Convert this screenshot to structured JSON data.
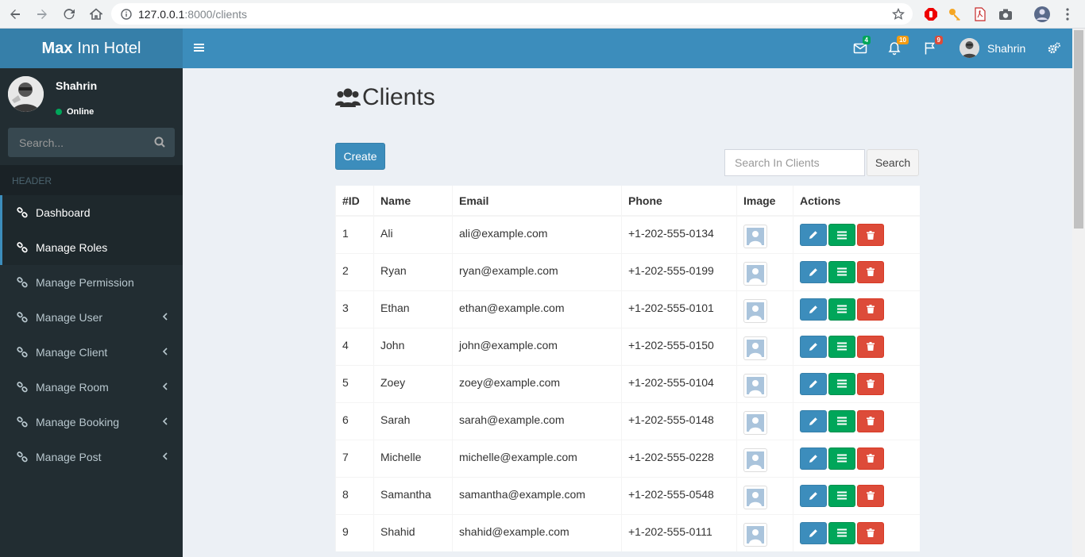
{
  "browser": {
    "url_host": "127.0.0.1",
    "url_path": ":8000/clients"
  },
  "header": {
    "brand_bold": "Max",
    "brand_rest": "Inn Hotel",
    "messages_count": "4",
    "notifications_count": "10",
    "flags_count": "9",
    "user_name": "Shahrin",
    "colors": {
      "topbar": "#3c8dbc",
      "logo": "#367fa9",
      "msg_badge": "#00a65a",
      "notif_badge": "#f39c12",
      "flag_badge": "#dd4b39"
    }
  },
  "sidebar": {
    "user_name": "Shahrin",
    "status": "Online",
    "search_placeholder": "Search...",
    "header": "HEADER",
    "items": [
      {
        "label": "Dashboard",
        "active": true
      },
      {
        "label": "Manage Roles",
        "active": true
      },
      {
        "label": "Manage Permission"
      },
      {
        "label": "Manage User",
        "has_children": true
      },
      {
        "label": "Manage Client",
        "has_children": true
      },
      {
        "label": "Manage Room",
        "has_children": true
      },
      {
        "label": "Manage Booking",
        "has_children": true
      },
      {
        "label": "Manage Post",
        "has_children": true
      }
    ]
  },
  "main": {
    "title": "Clients",
    "create_label": "Create",
    "search_placeholder": "Search In Clients",
    "search_label": "Search",
    "columns": [
      "#ID",
      "Name",
      "Email",
      "Phone",
      "Image",
      "Actions"
    ],
    "rows": [
      {
        "id": "1",
        "name": "Ali",
        "email": "ali@example.com",
        "phone": "+1-202-555-0134"
      },
      {
        "id": "2",
        "name": "Ryan",
        "email": "ryan@example.com",
        "phone": "+1-202-555-0199"
      },
      {
        "id": "3",
        "name": "Ethan",
        "email": "ethan@example.com",
        "phone": "+1-202-555-0101"
      },
      {
        "id": "4",
        "name": "John",
        "email": "john@example.com",
        "phone": "+1-202-555-0150"
      },
      {
        "id": "5",
        "name": "Zoey",
        "email": "zoey@example.com",
        "phone": "+1-202-555-0104"
      },
      {
        "id": "6",
        "name": "Sarah",
        "email": "sarah@example.com",
        "phone": "+1-202-555-0148"
      },
      {
        "id": "7",
        "name": "Michelle",
        "email": "michelle@example.com",
        "phone": "+1-202-555-0228"
      },
      {
        "id": "8",
        "name": "Samantha",
        "email": "samantha@example.com",
        "phone": "+1-202-555-0548"
      },
      {
        "id": "9",
        "name": "Shahid",
        "email": "shahid@example.com",
        "phone": "+1-202-555-0111"
      }
    ]
  }
}
